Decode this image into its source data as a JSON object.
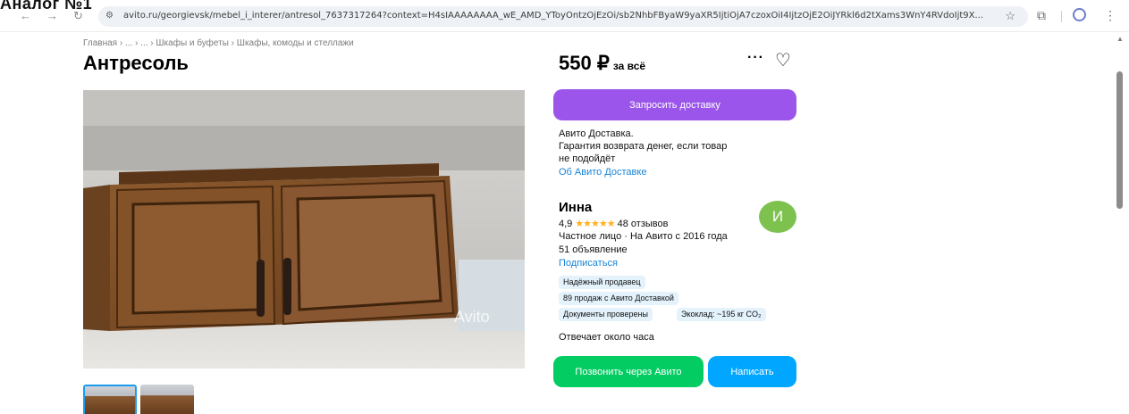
{
  "overlay_label": "Аналог №1",
  "browser": {
    "back_icon": "←",
    "forward_icon": "→",
    "reload_icon": "↻",
    "url": "avito.ru/georgievsk/mebel_i_interer/antresol_7637317264?context=H4sIAAAAAAAA_wE_AMD_YToyOntzOjEzOi/sb2NhbFByaW9yaXR5IjtiOjA7czoxOiI4IjtzOjE2OiJYRkl6d2tXams3WnY4RVdoIjt9X...",
    "star_icon": "☆",
    "extensions_icon": "⧉",
    "menu_icon": "⋮"
  },
  "breadcrumb": "Главная › ... › ... › Шкафы и буфеты › Шкафы, комоды и стеллажи",
  "title": "Антресоль",
  "watermark": "Avito",
  "price": {
    "amount": "550 ₽",
    "suffix": "за всё",
    "more_icon": "···",
    "heart_icon": "♡"
  },
  "delivery": {
    "button_label": "Запросить доставку",
    "text": "Авито Доставка.\nГарантия возврата денег, если товар не подойдёт",
    "link": "Об Авито Доставке"
  },
  "seller": {
    "name": "Инна",
    "rating": "4,9",
    "stars": "★★★★★",
    "reviews": "48 отзывов",
    "info": "Частное лицо · На Авито с 2016 года",
    "listings": "51 объявление",
    "subscribe": "Подписаться",
    "avatar_letter": "И"
  },
  "badges": [
    "Надёжный продавец",
    "89 продаж с Авито Доставкой",
    "Документы проверены",
    "Экоклад: ~195 кг CO₂"
  ],
  "response_time": "Отвечает около часа",
  "actions": {
    "call": "Позвонить через Авито",
    "write": "Написать"
  }
}
